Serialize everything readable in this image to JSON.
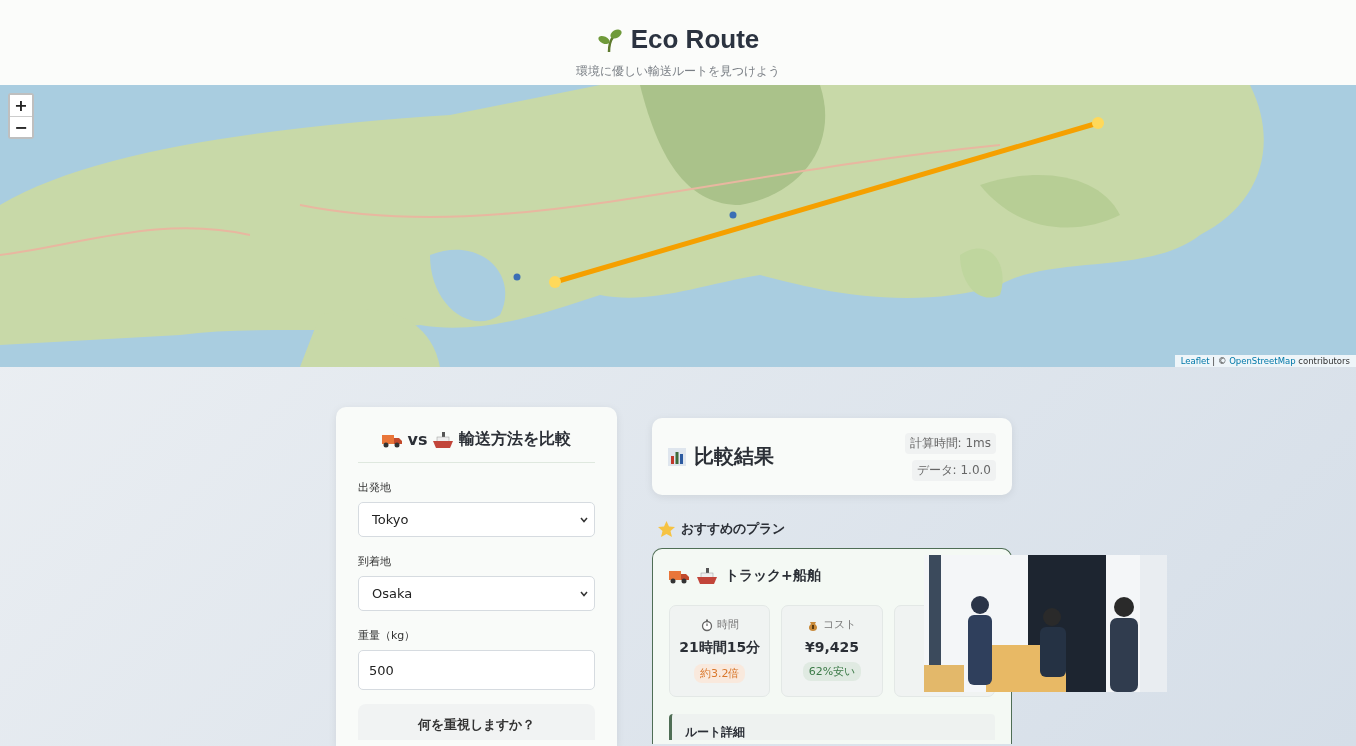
{
  "header": {
    "title": "Eco Route",
    "subtitle": "環境に優しい輸送ルートを見つけよう"
  },
  "map": {
    "kind": "picture",
    "zoom_in": "+",
    "zoom_out": "−",
    "attribution": {
      "link_1": "Leaflet",
      "middle": " | © ",
      "link_2": "OpenStreetMap",
      "suffix": " contributors"
    }
  },
  "form": {
    "title_vs": "vs",
    "title": "輸送方法を比較",
    "fields": [
      {
        "label": "出発地",
        "kind": "select",
        "value": "Tokyo"
      },
      {
        "label": "到着地",
        "kind": "select",
        "value": "Osaka"
      },
      {
        "label": "重量（kg）",
        "kind": "input",
        "value": "500"
      }
    ],
    "priority_title": "何を重視しますか？"
  },
  "results": {
    "title": "比較結果",
    "calc_time": "計算時間: 1ms",
    "data_version": "データ: 1.0.0",
    "recommended_title": "おすすめのプラン",
    "plan": {
      "name": "トラック+船舶",
      "stats": [
        {
          "kind": "time",
          "label": "時間",
          "value": "21時間15分",
          "badge": "約3.2倍",
          "color": "#d9772b"
        },
        {
          "kind": "cost",
          "label": "コスト",
          "value": "¥9,425",
          "badge": "62%安い",
          "color": "#3b7a47"
        }
      ],
      "detail_title": "ルート詳細"
    }
  }
}
